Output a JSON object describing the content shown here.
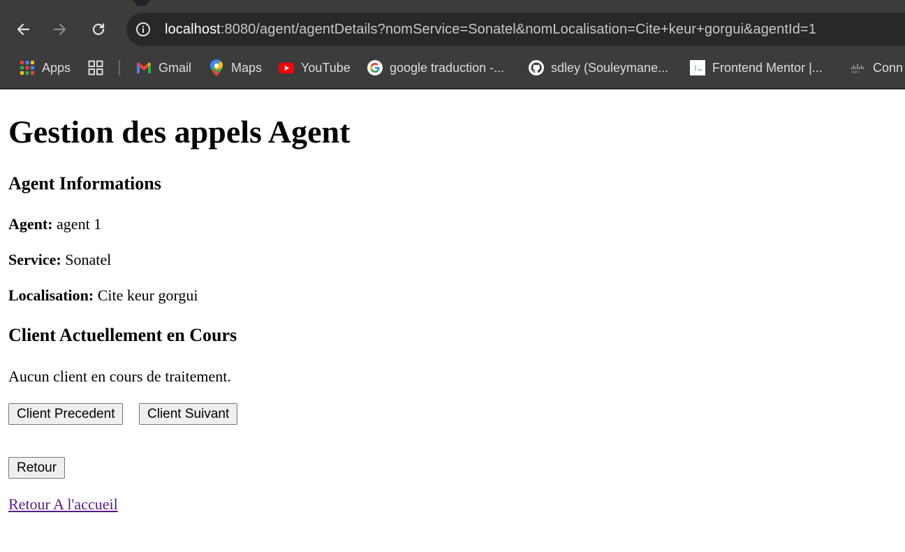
{
  "browser": {
    "url_host": "localhost",
    "url_rest": ":8080/agent/agentDetails?nomService=Sonatel&nomLocalisation=Cite+keur+gorgui&agentId=1",
    "bookmarks": [
      {
        "label": "Apps",
        "icon": "apps-grid-icon"
      },
      {
        "label": "",
        "icon": "tab-groups-icon"
      },
      {
        "label": "Gmail",
        "icon": "gmail-icon"
      },
      {
        "label": "Maps",
        "icon": "maps-icon"
      },
      {
        "label": "YouTube",
        "icon": "youtube-icon"
      },
      {
        "label": "google traduction -...",
        "icon": "google-icon"
      },
      {
        "label": "sdley (Souleymane...",
        "icon": "github-icon"
      },
      {
        "label": "Frontend Mentor |...",
        "icon": "frontend-mentor-icon"
      },
      {
        "label": "Conn",
        "icon": "cisco-icon"
      }
    ]
  },
  "page": {
    "title": "Gestion des appels Agent",
    "agent_section_title": "Agent Informations",
    "agent_label": "Agent:",
    "agent_value": " agent 1",
    "service_label": "Service:",
    "service_value": " Sonatel",
    "localisation_label": "Localisation:",
    "localisation_value": " Cite keur gorgui",
    "client_section_title": "Client Actuellement en Cours",
    "client_status": "Aucun client en cours de traitement.",
    "prev_button": "Client Precedent",
    "next_button": "Client Suivant",
    "back_button": "Retour",
    "home_link": "Retour A l'accueil"
  },
  "colors": {
    "chrome_bg": "#3c3c3c",
    "omnibox_bg": "#282828",
    "visited_link": "#551a8b"
  }
}
